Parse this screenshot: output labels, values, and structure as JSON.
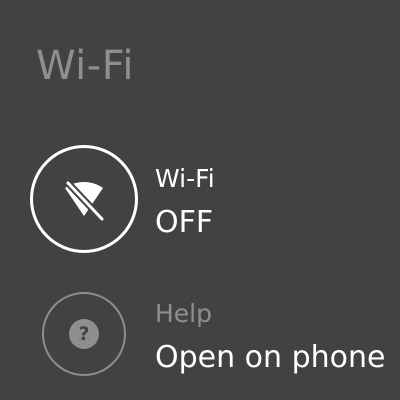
{
  "header": {
    "title": "Wi-Fi"
  },
  "settings": {
    "wifi": {
      "label": "Wi-Fi",
      "value": "OFF",
      "icon": "wifi-off-icon"
    },
    "help": {
      "label": "Help",
      "value": "Open on phone",
      "icon": "help-icon",
      "icon_glyph": "?"
    }
  },
  "colors": {
    "background": "#424242",
    "primary_text": "#ffffff",
    "secondary_text": "#8e8e8e"
  }
}
